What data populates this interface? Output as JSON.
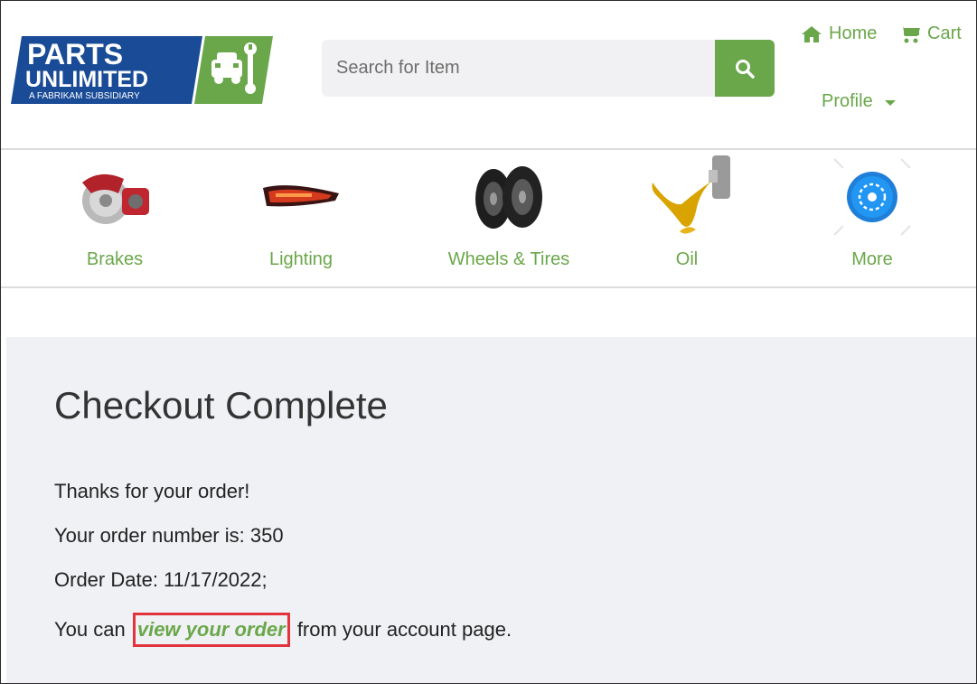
{
  "brand": {
    "line1": "PARTS",
    "line2": "UNLIMITED",
    "tagline": "A FABRIKAM SUBSIDIARY",
    "navy": "#1a4b96",
    "green": "#6aa74a"
  },
  "search": {
    "placeholder": "Search for Item",
    "icon": "search-icon"
  },
  "nav": {
    "home": "Home",
    "cart": "Cart",
    "profile": "Profile"
  },
  "categories": [
    {
      "label": "Brakes",
      "icon": "brake-image"
    },
    {
      "label": "Lighting",
      "icon": "tail-light-image"
    },
    {
      "label": "Wheels & Tires",
      "icon": "tires-image"
    },
    {
      "label": "Oil",
      "icon": "oil-image"
    },
    {
      "label": "More",
      "icon": "more-image"
    }
  ],
  "checkout": {
    "title": "Checkout Complete",
    "thanks": "Thanks for your order!",
    "order_number_text": "Your order number is: 350",
    "order_date_text": "Order Date: 11/17/2022;",
    "view_prefix": "You can",
    "view_link": "view your order",
    "view_suffix": "from your account page."
  },
  "colors": {
    "accent": "#6aa74a",
    "highlight_border": "#e2343c",
    "main_bg": "#f0f1f4"
  }
}
